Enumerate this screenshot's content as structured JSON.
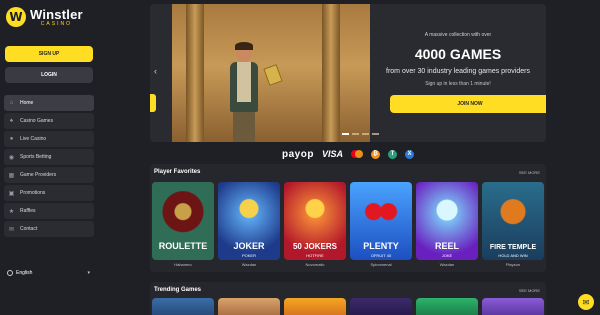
{
  "brand": {
    "name": "Winstler",
    "sub": "CASINO",
    "mark": "W"
  },
  "auth": {
    "signup_label": "SIGN UP",
    "login_label": "LOGIN"
  },
  "sidebar": {
    "items": [
      {
        "label": "Home",
        "icon": "home-icon",
        "active": true
      },
      {
        "label": "Casino Games",
        "icon": "cards-icon"
      },
      {
        "label": "Live Casino",
        "icon": "live-icon"
      },
      {
        "label": "Sports Betting",
        "icon": "ball-icon"
      },
      {
        "label": "Game Providers",
        "icon": "providers-icon"
      },
      {
        "label": "Promotions",
        "icon": "gift-icon"
      },
      {
        "label": "Raffles",
        "icon": "star-icon"
      },
      {
        "label": "Contact",
        "icon": "chat-icon"
      }
    ],
    "language": "English"
  },
  "hero": {
    "small": "A massive collection with over",
    "big": "4000 GAMES",
    "sub": "from over 30 industry leading games providers",
    "sub2": "Sign up in less than 1 minute!",
    "join_label": "JOIN NOW"
  },
  "payments": {
    "payop": "payop",
    "visa": "VISA"
  },
  "favorites": {
    "title": "Player Favorites",
    "see_more": "SEE MORE",
    "games": [
      {
        "name": "ROULETTE",
        "subtitle": "",
        "provider": "Habanero"
      },
      {
        "name": "JOKER",
        "subtitle": "POKER",
        "provider": "Wazdan"
      },
      {
        "name": "50 JOKERS",
        "subtitle": "HOTFIRE",
        "provider": "Novomatic"
      },
      {
        "name": "PLENTY",
        "subtitle": "OFRUIT 40",
        "provider": "Spinomenal"
      },
      {
        "name": "REEL",
        "subtitle": "JOKE",
        "provider": "Wazdan"
      },
      {
        "name": "FIRE TEMPLE",
        "subtitle": "HOLD AND WIN",
        "provider": "Playson"
      }
    ]
  },
  "trending": {
    "title": "Trending Games",
    "see_more": "SEE MORE"
  },
  "colors": {
    "accent": "#ffdd22",
    "bg": "#1f2025",
    "panel": "#26272d"
  }
}
